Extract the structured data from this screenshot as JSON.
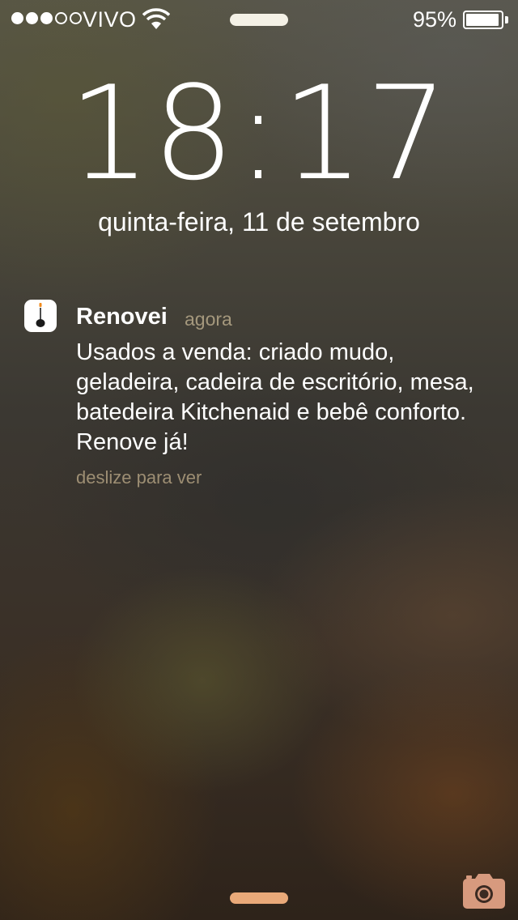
{
  "status_bar": {
    "signal_bars_total": 5,
    "signal_bars_filled": 3,
    "carrier": "VIVO",
    "wifi_icon": "wifi-icon",
    "battery_percent_label": "95%",
    "battery_level": 0.95
  },
  "lock_screen": {
    "time": "18:17",
    "date": "quinta-feira, 11 de setembro"
  },
  "notification": {
    "app_icon": "renovei-app-icon",
    "app_name": "Renovei",
    "time": "agora",
    "message": "Usados a venda: criado mudo, geladeira, cadeira de escritório, mesa, batedeira Kitchenaid e bebê conforto. Renove já!",
    "hint": "deslize para ver"
  },
  "bottom": {
    "camera_icon": "camera-icon"
  },
  "colors": {
    "meta_text": "#a5987d",
    "hint_text": "#9d8e73",
    "grabber": "#e9a979",
    "camera": "#d79a7e",
    "app_icon_orange": "#f08a1c"
  }
}
